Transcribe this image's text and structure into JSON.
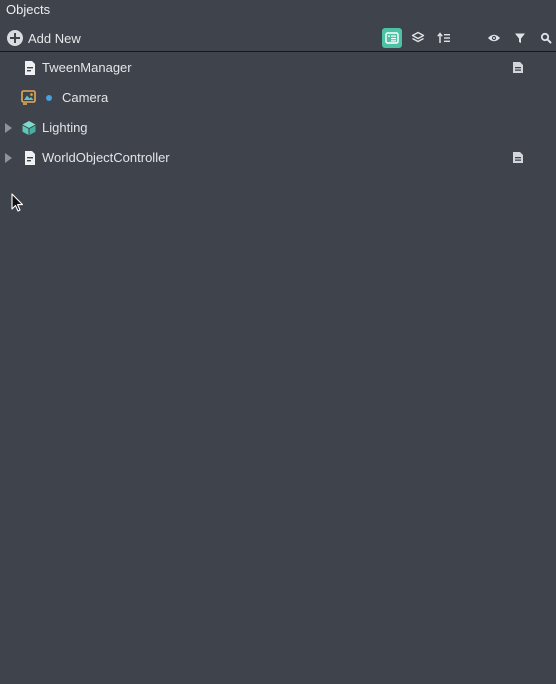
{
  "panel": {
    "title": "Objects"
  },
  "toolbar": {
    "add_new_label": "Add New",
    "buttons": [
      {
        "icon": "hierarchy-list-icon",
        "active": true
      },
      {
        "icon": "layers-icon",
        "active": false
      },
      {
        "icon": "sort-order-icon",
        "active": false
      },
      {
        "icon": "eye-icon",
        "active": false
      },
      {
        "icon": "filter-icon",
        "active": false
      },
      {
        "icon": "search-icon",
        "active": false
      }
    ],
    "active_color": "#4cc1a4"
  },
  "tree": {
    "rows": [
      {
        "name": "TweenManager",
        "icon": "script-icon",
        "expandable": false,
        "has_script_badge": true
      },
      {
        "name": "Camera",
        "icon": "camera-icon",
        "expandable": false,
        "has_status_dot": true,
        "dot_color": "#4a9fe0"
      },
      {
        "name": "Lighting",
        "icon": "light-cube-icon",
        "expandable": true,
        "icon_color": "#5ec7b8"
      },
      {
        "name": "WorldObjectController",
        "icon": "script-icon",
        "expandable": true,
        "has_script_badge": true
      }
    ]
  },
  "colors": {
    "background": "#3f434b",
    "text": "#e3e5e8",
    "accent": "#4cc1a4"
  }
}
